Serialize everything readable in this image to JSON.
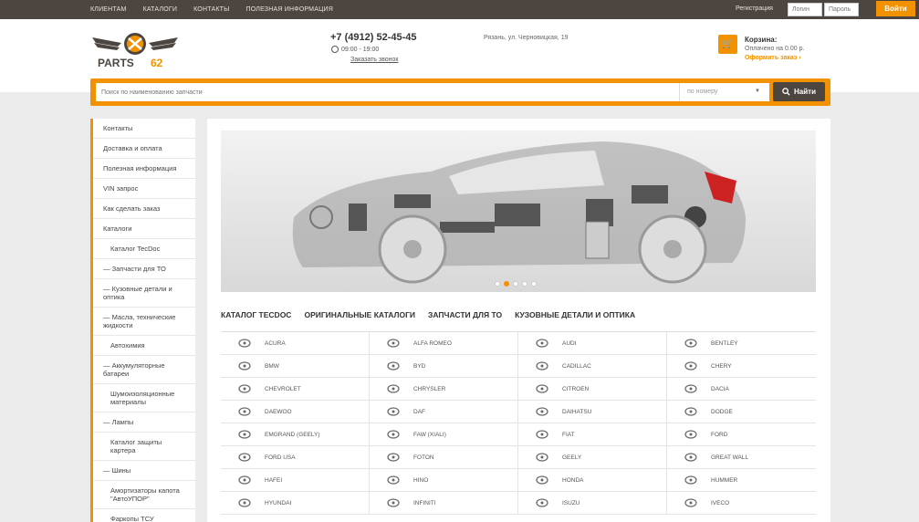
{
  "topnav": [
    "КЛИЕНТАМ",
    "КАТАЛОГИ",
    "КОНТАКТЫ",
    "ПОЛЕЗНАЯ ИНФОРМАЦИЯ"
  ],
  "auth": {
    "register": "Регистрация",
    "login_placeholder": "Логин",
    "password_placeholder": "Пароль",
    "login_button": "Войти"
  },
  "header": {
    "logo_text": "PARTS",
    "logo_num": "62",
    "phone": "+7 (4912) 52-45-45",
    "hours": "09:00 - 19:00",
    "callback": "Заказать звонок",
    "address": "Рязань, ул. Черновицкая, 19",
    "cart_title": "Корзина:",
    "cart_sum": "Оплачено на 0.00 р.",
    "cart_checkout": "Оформить заказ",
    "accent": "#f39200"
  },
  "search": {
    "placeholder": "Поиск по наименованию запчасти",
    "mode": "по номеру",
    "button": "Найти"
  },
  "sidebar": [
    {
      "label": "Контакты",
      "sub": false
    },
    {
      "label": "Доставка и оплата",
      "sub": false
    },
    {
      "label": "Полезная информация",
      "sub": false
    },
    {
      "label": "VIN запрос",
      "sub": false
    },
    {
      "label": "Как сделать заказ",
      "sub": false
    },
    {
      "label": "Каталоги",
      "sub": false
    },
    {
      "label": "Каталог TecDoc",
      "sub": true
    },
    {
      "label": "— Запчасти для ТО",
      "sub": false
    },
    {
      "label": "— Кузовные детали и оптика",
      "sub": false
    },
    {
      "label": "— Масла, технические жидкости",
      "sub": false
    },
    {
      "label": "Автохимия",
      "sub": true
    },
    {
      "label": "— Аккумуляторные батареи",
      "sub": false
    },
    {
      "label": "Шумоизоляционные материалы",
      "sub": true
    },
    {
      "label": "— Лампы",
      "sub": false
    },
    {
      "label": "Каталог защиты картера",
      "sub": true
    },
    {
      "label": "— Шины",
      "sub": false
    },
    {
      "label": "Амортизаторы капота \"АвтоУПОР\"",
      "sub": true
    },
    {
      "label": "Фаркопы ТСУ",
      "sub": true
    }
  ],
  "tabs": [
    "КАТАЛОГ TECDOC",
    "ОРИГИНАЛЬНЫЕ КАТАЛОГИ",
    "ЗАПЧАСТИ ДЛЯ ТО",
    "КУЗОВНЫЕ ДЕТАЛИ И ОПТИКА"
  ],
  "brands": [
    {
      "name": "ACURA",
      "icon": "acura-logo"
    },
    {
      "name": "ALFA ROMEO",
      "icon": "alfa-romeo-logo"
    },
    {
      "name": "AUDI",
      "icon": "audi-logo"
    },
    {
      "name": "BENTLEY",
      "icon": "bentley-logo"
    },
    {
      "name": "BMW",
      "icon": "bmw-logo"
    },
    {
      "name": "BYD",
      "icon": "byd-logo"
    },
    {
      "name": "CADILLAC",
      "icon": "cadillac-logo"
    },
    {
      "name": "CHERY",
      "icon": "chery-logo"
    },
    {
      "name": "CHEVROLET",
      "icon": "chevrolet-logo"
    },
    {
      "name": "CHRYSLER",
      "icon": "chrysler-logo"
    },
    {
      "name": "CITROEN",
      "icon": "citroen-logo"
    },
    {
      "name": "DACIA",
      "icon": "dacia-logo"
    },
    {
      "name": "DAEWOO",
      "icon": "daewoo-logo"
    },
    {
      "name": "DAF",
      "icon": "daf-logo"
    },
    {
      "name": "DAIHATSU",
      "icon": "daihatsu-logo"
    },
    {
      "name": "DODGE",
      "icon": "dodge-logo"
    },
    {
      "name": "EMGRAND (GEELY)",
      "icon": "emgrand-logo"
    },
    {
      "name": "FAW (XIALI)",
      "icon": "faw-logo"
    },
    {
      "name": "FIAT",
      "icon": "fiat-logo"
    },
    {
      "name": "FORD",
      "icon": "ford-logo"
    },
    {
      "name": "FORD USA",
      "icon": "ford-usa-logo"
    },
    {
      "name": "FOTON",
      "icon": "foton-logo"
    },
    {
      "name": "GEELY",
      "icon": "geely-logo"
    },
    {
      "name": "GREAT WALL",
      "icon": "great-wall-logo"
    },
    {
      "name": "HAFEI",
      "icon": "hafei-logo"
    },
    {
      "name": "HINO",
      "icon": "hino-logo"
    },
    {
      "name": "HONDA",
      "icon": "honda-logo"
    },
    {
      "name": "HUMMER",
      "icon": "hummer-logo"
    },
    {
      "name": "HYUNDAI",
      "icon": "hyundai-logo"
    },
    {
      "name": "INFINITI",
      "icon": "infiniti-logo"
    },
    {
      "name": "ISUZU",
      "icon": "isuzu-logo"
    },
    {
      "name": "IVECO",
      "icon": "iveco-logo"
    }
  ]
}
